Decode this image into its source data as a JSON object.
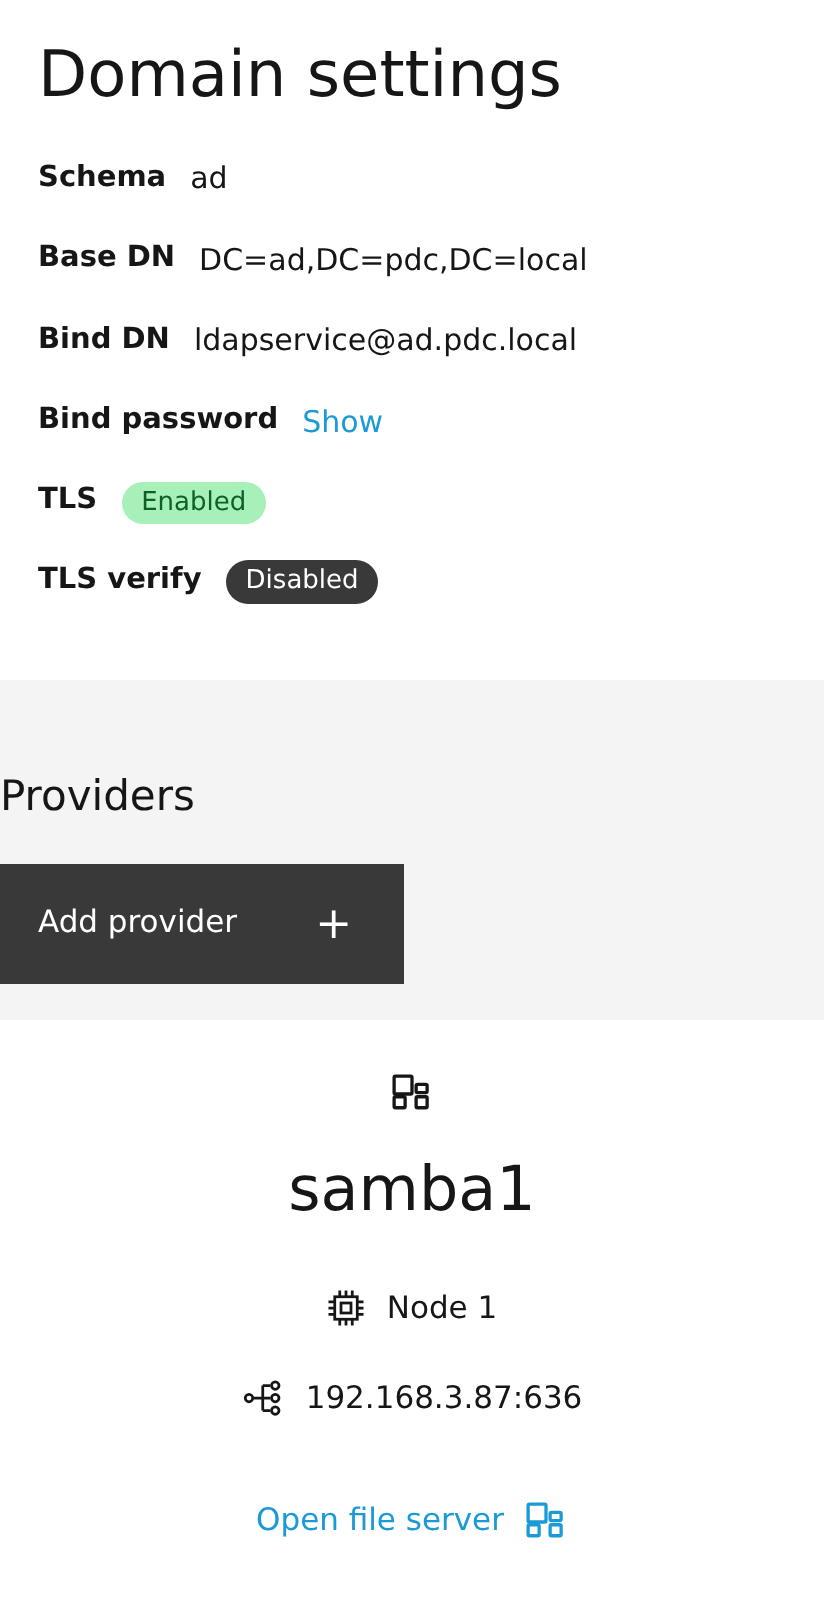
{
  "title": "Domain settings",
  "fields": [
    {
      "label": "Schema",
      "kind": "text",
      "value": "ad"
    },
    {
      "label": "Base DN",
      "kind": "text",
      "value": "DC=ad,DC=pdc,DC=local"
    },
    {
      "label": "Bind DN",
      "kind": "text",
      "value": "ldapservice@ad.pdc.local"
    },
    {
      "label": "Bind password",
      "kind": "link",
      "value": "Show"
    },
    {
      "label": "TLS",
      "kind": "tag",
      "value": "Enabled",
      "on": true
    },
    {
      "label": "TLS verify",
      "kind": "tag",
      "value": "Disabled",
      "on": false
    }
  ],
  "providers": {
    "title": "Providers",
    "add_button": "Add provider",
    "add_icon": "+"
  },
  "provider": {
    "name": "samba1",
    "node": "Node 1",
    "address": "192.168.3.87:636",
    "link": "Open file server"
  }
}
